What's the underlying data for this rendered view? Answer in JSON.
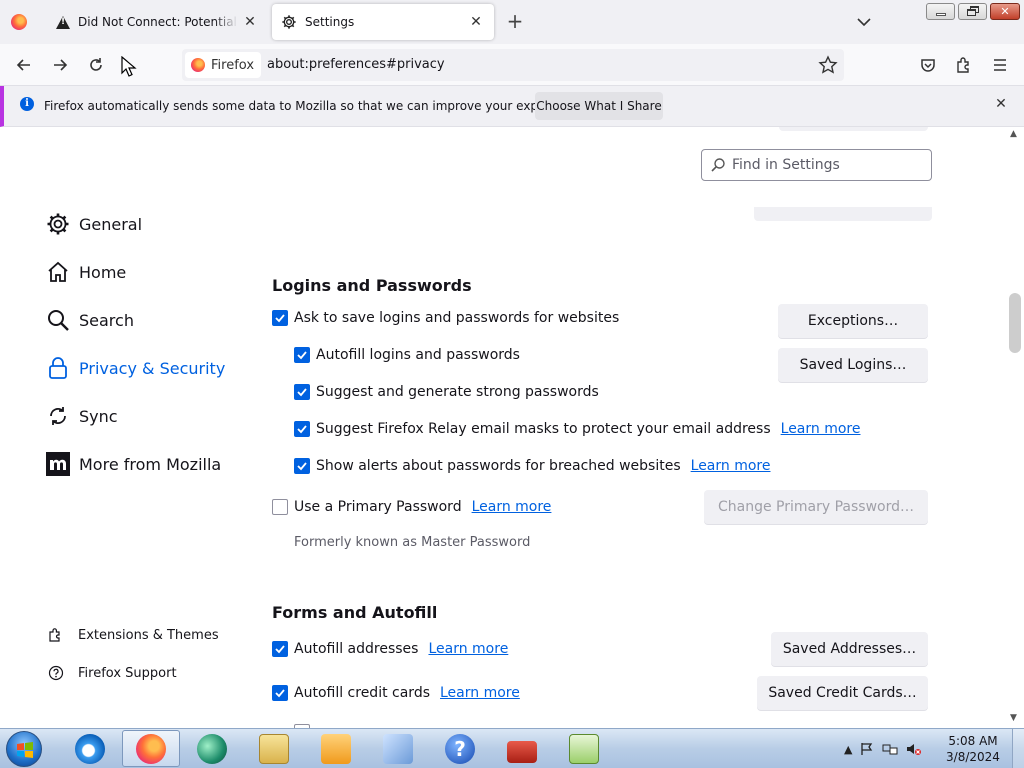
{
  "tabs": [
    {
      "title": "Did Not Connect: Potential Security Issue",
      "close": "✕"
    },
    {
      "title": "Settings",
      "close": "✕"
    }
  ],
  "new_tab": "+",
  "window": {
    "close": "✕"
  },
  "nav": {
    "identity": "Firefox",
    "url": "about:preferences#privacy"
  },
  "notification": {
    "text": "Firefox automatically sends some data to Mozilla so that we can improve your experience.",
    "button": "Choose What I Share",
    "info": "i",
    "close": "✕"
  },
  "search": {
    "placeholder": "Find in Settings"
  },
  "sidebar": {
    "items": [
      {
        "label": "General",
        "icon": "gear-icon"
      },
      {
        "label": "Home",
        "icon": "home-icon"
      },
      {
        "label": "Search",
        "icon": "search-icon"
      },
      {
        "label": "Privacy & Security",
        "icon": "lock-icon",
        "selected": true
      },
      {
        "label": "Sync",
        "icon": "sync-icon"
      },
      {
        "label": "More from Mozilla",
        "icon": "mozilla-icon"
      }
    ],
    "footer": [
      {
        "label": "Extensions & Themes",
        "icon": "puzzle-icon"
      },
      {
        "label": "Firefox Support",
        "icon": "help-icon"
      }
    ]
  },
  "logins": {
    "title": "Logins and Passwords",
    "ask_save": "Ask to save logins and passwords for websites",
    "autofill": "Autofill logins and passwords",
    "suggest": "Suggest and generate strong passwords",
    "relay": "Suggest Firefox Relay email masks to protect your email address",
    "breached": "Show alerts about passwords for breached websites",
    "primary": "Use a Primary Password",
    "primary_note": "Formerly known as Master Password",
    "learn_more": "Learn more",
    "exceptions_btn": "Exceptions…",
    "saved_logins_btn": "Saved Logins…",
    "change_primary_btn": "Change Primary Password…"
  },
  "forms": {
    "title": "Forms and Autofill",
    "addresses": "Autofill addresses",
    "cards": "Autofill credit cards",
    "learn_more": "Learn more",
    "saved_addresses_btn": "Saved Addresses…",
    "saved_cards_btn": "Saved Credit Cards…"
  },
  "taskbar": {
    "time": "5:08 AM",
    "date": "3/8/2024"
  },
  "colors": {
    "accent": "#0061e0",
    "notification_bar": "#b833e1"
  }
}
